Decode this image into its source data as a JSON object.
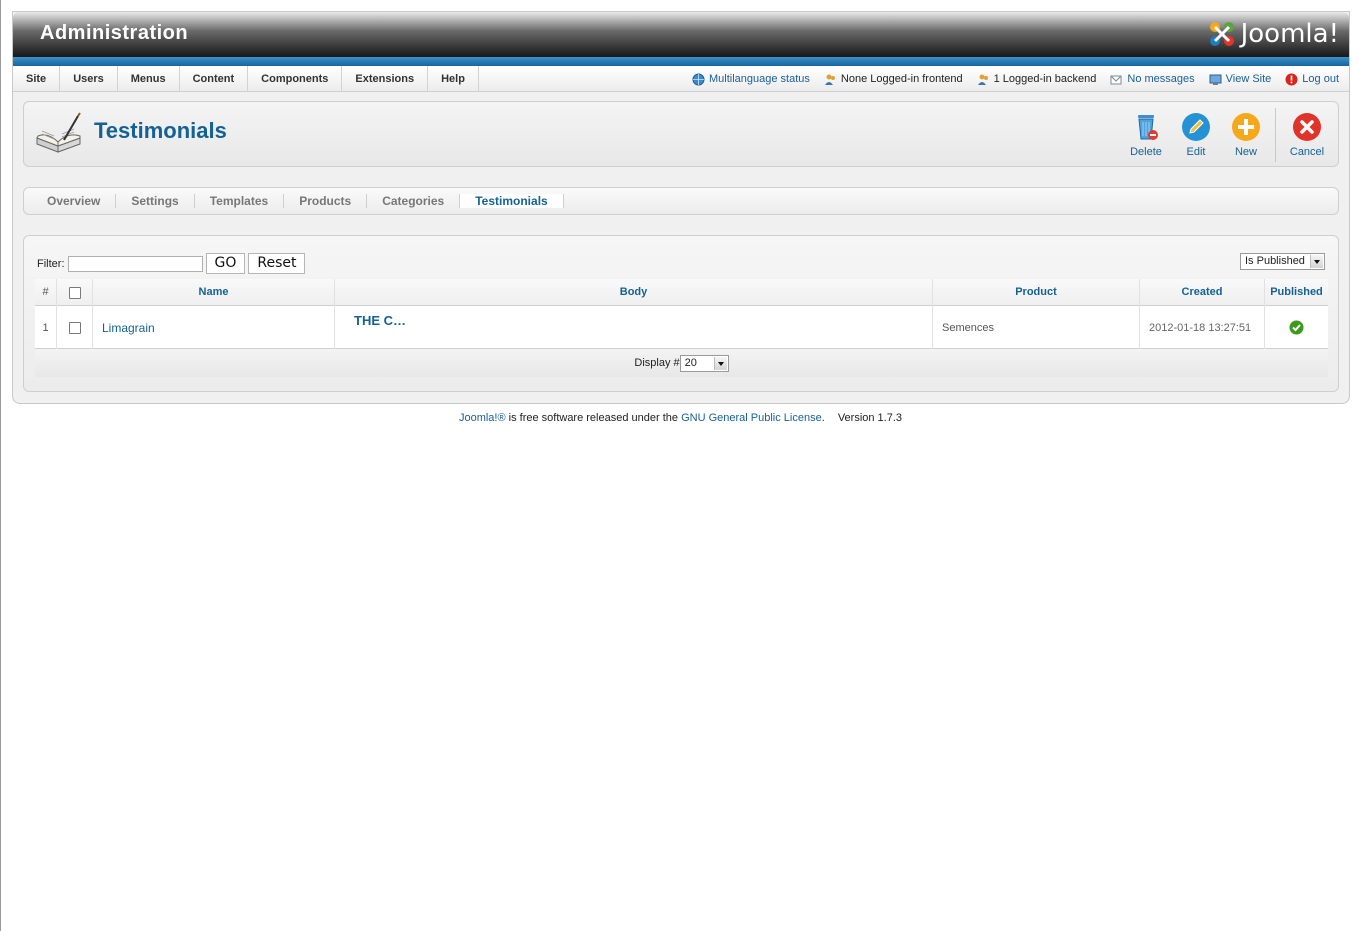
{
  "header": {
    "title": "Administration",
    "logo_text": "Joomla!"
  },
  "menubar": {
    "menus": [
      "Site",
      "Users",
      "Menus",
      "Content",
      "Components",
      "Extensions",
      "Help"
    ],
    "multilanguage": "Multilanguage status",
    "frontend": "None Logged-in frontend",
    "backend": "1 Logged-in backend",
    "messages": "No messages",
    "view_site": "View Site",
    "logout": "Log out"
  },
  "toolbar": {
    "page_title": "Testimonials",
    "delete": "Delete",
    "edit": "Edit",
    "new": "New",
    "cancel": "Cancel"
  },
  "tabs": [
    "Overview",
    "Settings",
    "Templates",
    "Products",
    "Categories",
    "Testimonials"
  ],
  "active_tab": "Testimonials",
  "filter": {
    "label": "Filter:",
    "value": "",
    "go": "GO",
    "reset": "Reset",
    "published_select": "Is Published"
  },
  "table": {
    "headers": {
      "num": "#",
      "name": "Name",
      "body": "Body",
      "product": "Product",
      "created": "Created",
      "published": "Published"
    },
    "rows": [
      {
        "num": "1",
        "name": "Limagrain",
        "body": "THE C…",
        "product": "Semences",
        "created": "2012-01-18 13:27:51",
        "published": true
      }
    ],
    "display_label": "Display #",
    "display_value": "20"
  },
  "footer": {
    "joomla_link": "Joomla!®",
    "text": " is free software released under the ",
    "license_link": "GNU General Public License",
    "version": "Version 1.7.3"
  },
  "colors": {
    "accent": "#146295",
    "blue_bar": "#2a7cb8"
  }
}
